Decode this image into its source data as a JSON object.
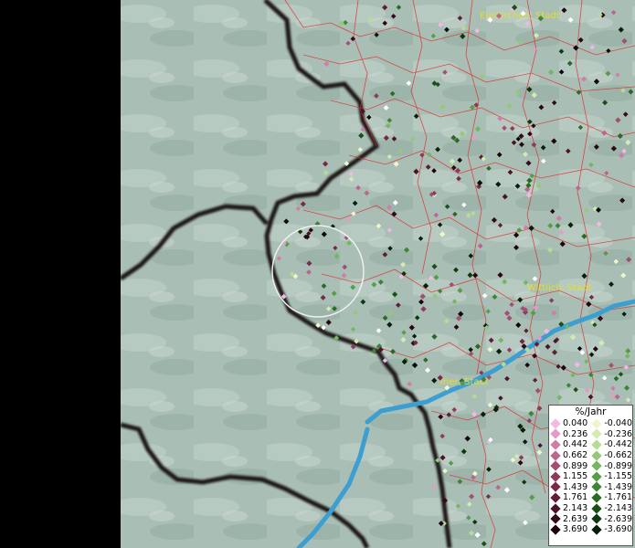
{
  "places": [
    {
      "name": "Euskirchen, Stadt"
    },
    {
      "name": "Wittlich, Stadt"
    },
    {
      "name": "Trier, Stadt"
    }
  ],
  "legend": {
    "title": "%/Jahr",
    "positive": [
      {
        "label": "0.040",
        "color": "#f2b8e6"
      },
      {
        "label": "0.236",
        "color": "#e39cc6"
      },
      {
        "label": "0.442",
        "color": "#d07ea8"
      },
      {
        "label": "0.662",
        "color": "#bc668d"
      },
      {
        "label": "0.899",
        "color": "#a54d72"
      },
      {
        "label": "1.155",
        "color": "#8e3a5c"
      },
      {
        "label": "1.439",
        "color": "#762a48"
      },
      {
        "label": "1.761",
        "color": "#5f1d36"
      },
      {
        "label": "2.143",
        "color": "#491328"
      },
      {
        "label": "2.639",
        "color": "#330b1b"
      },
      {
        "label": "3.690",
        "color": "#1e040d"
      }
    ],
    "negative": [
      {
        "label": "-0.040",
        "color": "#f0f6cc"
      },
      {
        "label": "-0.236",
        "color": "#d2ebb0"
      },
      {
        "label": "-0.442",
        "color": "#b5dc95"
      },
      {
        "label": "-0.662",
        "color": "#95c97a"
      },
      {
        "label": "-0.899",
        "color": "#76b561"
      },
      {
        "label": "-1.155",
        "color": "#579d48"
      },
      {
        "label": "-1.439",
        "color": "#3e8434"
      },
      {
        "label": "-1.761",
        "color": "#2a6a24"
      },
      {
        "label": "-2.143",
        "color": "#1a5018"
      },
      {
        "label": "-2.639",
        "color": "#0d380e"
      },
      {
        "label": "-3.690",
        "color": "#052006"
      }
    ]
  }
}
